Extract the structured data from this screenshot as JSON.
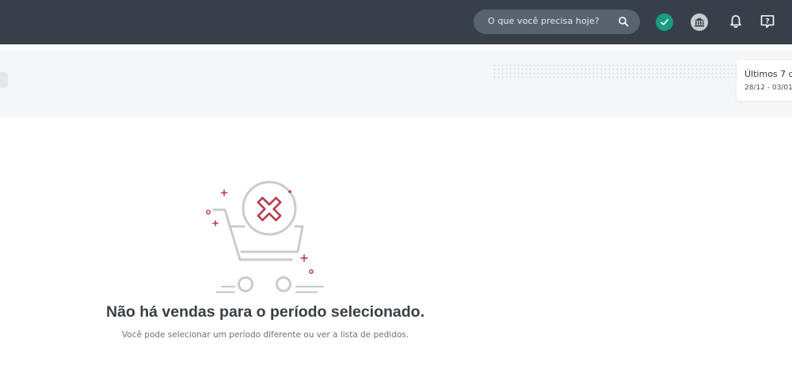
{
  "header": {
    "search": {
      "placeholder": "O que você precisa hoje?"
    },
    "icons": [
      "search-icon",
      "check-status-icon",
      "bank-icon",
      "bell-icon",
      "help-icon"
    ]
  },
  "filter": {
    "date_label": "Últimos 7 d",
    "date_range": "28/12 - 03/01"
  },
  "empty_state": {
    "title": "Não há vendas para o período selecionado.",
    "subtitle": "Você pode selecionar um período diferente ou ver a lista de pedidos.",
    "illustration": "empty-cart-icon"
  },
  "colors": {
    "header_bg": "#363f4a",
    "search_bg": "#596370",
    "status_green": "#1a9c81",
    "accent_red": "#b83a4b"
  }
}
